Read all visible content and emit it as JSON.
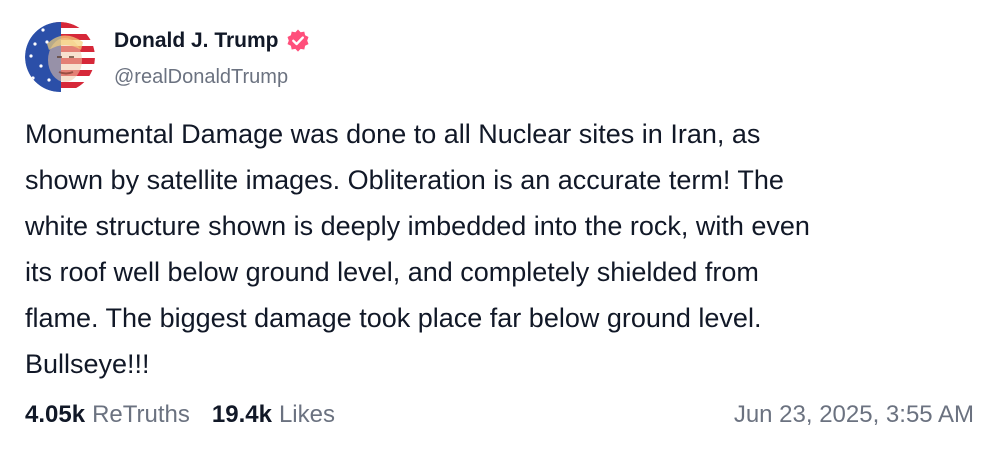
{
  "author": {
    "display_name": "Donald J. Trump",
    "handle": "@realDonaldTrump",
    "verified": true,
    "verified_color": "#ff4f7b",
    "avatar_icon": "flag-portrait-avatar"
  },
  "post": {
    "lines": [
      "Monumental Damage was done to all Nuclear sites in Iran, as",
      "shown by satellite images. Obliteration is an accurate term! The",
      "white structure shown is deeply imbedded into the rock, with even",
      "its roof well below ground level, and completely shielded from",
      "flame. The biggest damage took place far below ground level.",
      "Bullseye!!!"
    ]
  },
  "stats": {
    "retruths_count": "4.05k",
    "retruths_label": "ReTruths",
    "likes_count": "19.4k",
    "likes_label": "Likes"
  },
  "timestamp": "Jun 23, 2025, 3:55 AM",
  "colors": {
    "text_primary": "#111827",
    "text_secondary": "#6b7280",
    "background": "#ffffff"
  }
}
